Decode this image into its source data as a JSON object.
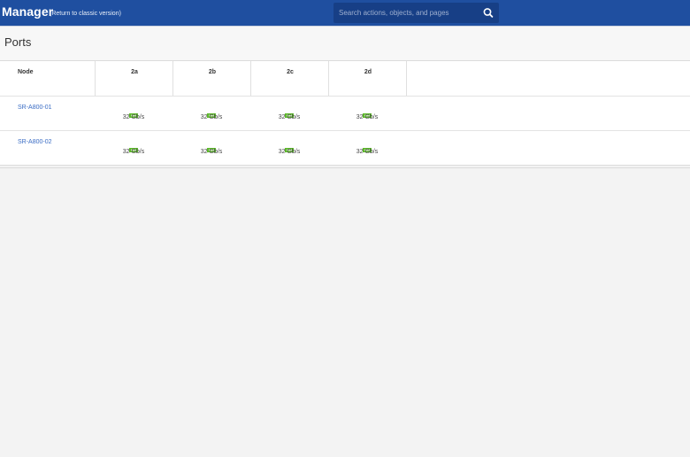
{
  "header": {
    "app_title": "Manager",
    "classic_link": "(Return to classic version)",
    "search_placeholder": "Search actions, objects, and pages",
    "search_icon": "search-icon",
    "color": "#1f4fa0"
  },
  "page": {
    "title": "Ports"
  },
  "table": {
    "columns": [
      "Node",
      "2a",
      "2b",
      "2c",
      "2d"
    ],
    "rows": [
      {
        "node": "SR-A800-01",
        "ports": [
          {
            "status_icon": "port-up-icon",
            "speed": "32 Gb/s"
          },
          {
            "status_icon": "port-up-icon",
            "speed": "32 Gb/s"
          },
          {
            "status_icon": "port-up-icon",
            "speed": "32 Gb/s"
          },
          {
            "status_icon": "port-up-icon",
            "speed": "32 Gb/s"
          }
        ]
      },
      {
        "node": "SR-A800-02",
        "ports": [
          {
            "status_icon": "port-up-icon",
            "speed": "32 Gb/s"
          },
          {
            "status_icon": "port-up-icon",
            "speed": "32 Gb/s"
          },
          {
            "status_icon": "port-up-icon",
            "speed": "32 Gb/s"
          },
          {
            "status_icon": "port-up-icon",
            "speed": "32 Gb/s"
          }
        ]
      }
    ],
    "status_color": "#5cb82a"
  }
}
